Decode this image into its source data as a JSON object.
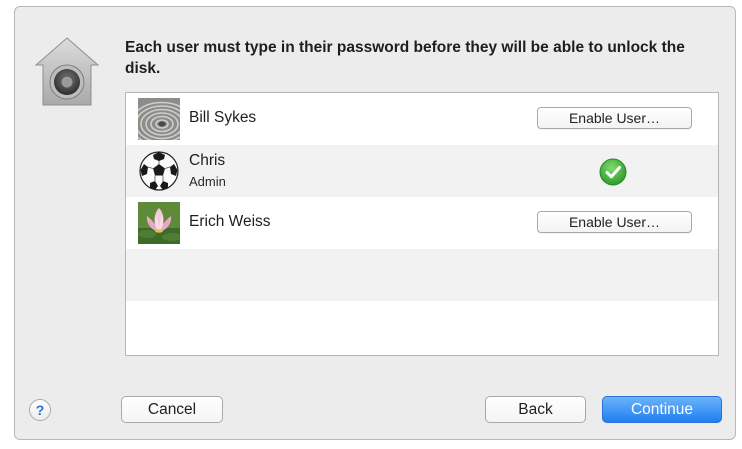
{
  "message": "Each user must type in their password before they will be able to unlock the disk.",
  "users": [
    {
      "name": "Bill Sykes",
      "action": "Enable User…",
      "avatar": "zen-sand-ripples"
    },
    {
      "name": "Chris",
      "role": "Admin",
      "status": "enabled",
      "avatar": "soccer-ball",
      "status_icon": "green-checkmark-icon"
    },
    {
      "name": "Erich Weiss",
      "action": "Enable User…",
      "avatar": "pink-lotus-flower"
    }
  ],
  "buttons": {
    "help": "?",
    "cancel": "Cancel",
    "back": "Back",
    "continue": "Continue"
  },
  "colors": {
    "continue_button": "#1e7ef2",
    "checkmark": "#3aa83a",
    "window_background": "#ececec"
  }
}
